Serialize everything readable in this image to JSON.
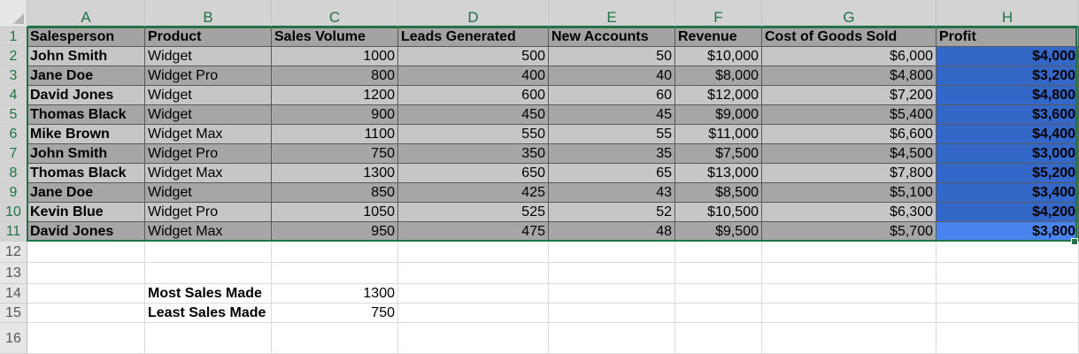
{
  "columns": [
    "A",
    "B",
    "C",
    "D",
    "E",
    "F",
    "G",
    "H"
  ],
  "rows": [
    "1",
    "2",
    "3",
    "4",
    "5",
    "6",
    "7",
    "8",
    "9",
    "10",
    "11",
    "12",
    "13",
    "14",
    "15",
    "16"
  ],
  "table": {
    "headers": [
      "Salesperson",
      "Product",
      "Sales Volume",
      "Leads Generated",
      "New Accounts",
      "Revenue",
      "Cost of Goods Sold",
      "Profit"
    ],
    "data": [
      [
        "John Smith",
        "Widget",
        "1000",
        "500",
        "50",
        "$10,000",
        "$6,000",
        "$4,000"
      ],
      [
        "Jane Doe",
        "Widget Pro",
        "800",
        "400",
        "40",
        "$8,000",
        "$4,800",
        "$3,200"
      ],
      [
        "David Jones",
        "Widget",
        "1200",
        "600",
        "60",
        "$12,000",
        "$7,200",
        "$4,800"
      ],
      [
        "Thomas Black",
        "Widget",
        "900",
        "450",
        "45",
        "$9,000",
        "$5,400",
        "$3,600"
      ],
      [
        "Mike Brown",
        "Widget Max",
        "1100",
        "550",
        "55",
        "$11,000",
        "$6,600",
        "$4,400"
      ],
      [
        "John Smith",
        "Widget Pro",
        "750",
        "350",
        "35",
        "$7,500",
        "$4,500",
        "$3,000"
      ],
      [
        "Thomas Black",
        "Widget Max",
        "1300",
        "650",
        "65",
        "$13,000",
        "$7,800",
        "$5,200"
      ],
      [
        "Jane Doe",
        "Widget",
        "850",
        "425",
        "43",
        "$8,500",
        "$5,100",
        "$3,400"
      ],
      [
        "Kevin Blue",
        "Widget Pro",
        "1050",
        "525",
        "52",
        "$10,500",
        "$6,300",
        "$4,200"
      ],
      [
        "David Jones",
        "Widget Max",
        "950",
        "475",
        "48",
        "$9,500",
        "$5,700",
        "$3,800"
      ]
    ]
  },
  "summary": [
    {
      "label": "Most Sales Made",
      "value": "1300"
    },
    {
      "label": "Least Sales Made",
      "value": "750"
    }
  ],
  "colors": {
    "accent": "#217346",
    "profit_fill": "#3468c8",
    "active_cell": "#4784ee",
    "band_light": "#c6c6c6",
    "band_dark": "#a6a6a6"
  }
}
